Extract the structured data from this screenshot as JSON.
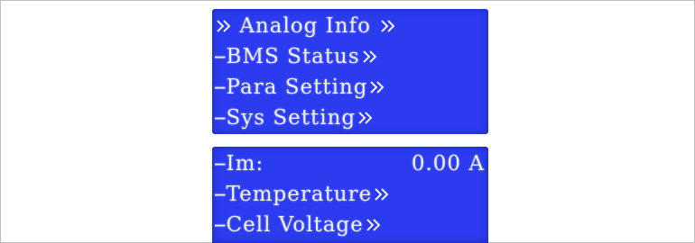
{
  "main_menu": {
    "items": [
      {
        "prefix": "",
        "label": "Analog Info",
        "leading_chevron": true
      },
      {
        "prefix": "--",
        "label": "BMS Status",
        "leading_chevron": false
      },
      {
        "prefix": "--",
        "label": "Para Setting",
        "leading_chevron": false
      },
      {
        "prefix": "--",
        "label": "Sys Setting",
        "leading_chevron": false
      }
    ]
  },
  "analog_menu": {
    "current": {
      "prefix": "--",
      "label": "Im:",
      "value": "0.00 A"
    },
    "items": [
      {
        "prefix": "--",
        "label": "Temperature"
      },
      {
        "prefix": "--",
        "label": "Cell Voltage"
      }
    ]
  },
  "icons": {
    "submenu": "double-chevron-right-icon"
  },
  "colors": {
    "lcd_background": "#2b3cf0",
    "lcd_text": "#eef0ff"
  }
}
